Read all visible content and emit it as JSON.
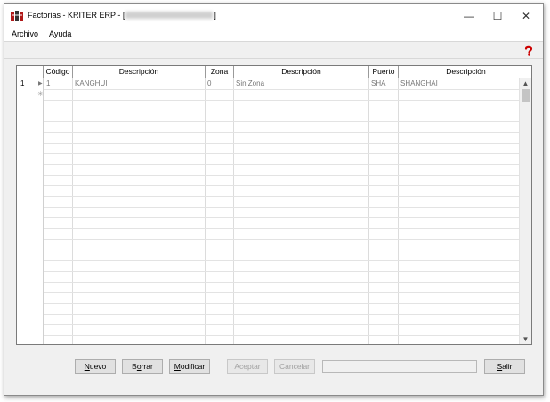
{
  "window": {
    "title_prefix": "Factorias - KRITER ERP - [",
    "title_suffix": "]",
    "minimize_glyph": "—",
    "maximize_glyph": "☐",
    "close_glyph": "✕"
  },
  "menu": {
    "items": [
      "Archivo",
      "Ayuda"
    ]
  },
  "grid": {
    "columns": [
      "Código",
      "Descripción",
      "Zona",
      "Descripción",
      "Puerto",
      "Descripción"
    ],
    "row_number": "1",
    "current_row_glyph": "▶",
    "new_row_glyph": "✳",
    "rows": [
      [
        "1",
        "KANGHUI",
        "0",
        "Sin Zona",
        "SHA",
        "SHANGHAI"
      ]
    ]
  },
  "buttons": {
    "nuevo_first": "N",
    "nuevo_rest": "uevo",
    "borrar_first": "B",
    "borrar_mid": "o",
    "borrar_rest": "rrar",
    "modificar_first": "M",
    "modificar_rest": "odificar",
    "aceptar": "Aceptar",
    "cancelar": "Cancelar",
    "salir_first": "S",
    "salir_rest": "alir"
  },
  "colors": {
    "window_bg": "#f0f0f0",
    "help_icon": "#cc0000"
  }
}
